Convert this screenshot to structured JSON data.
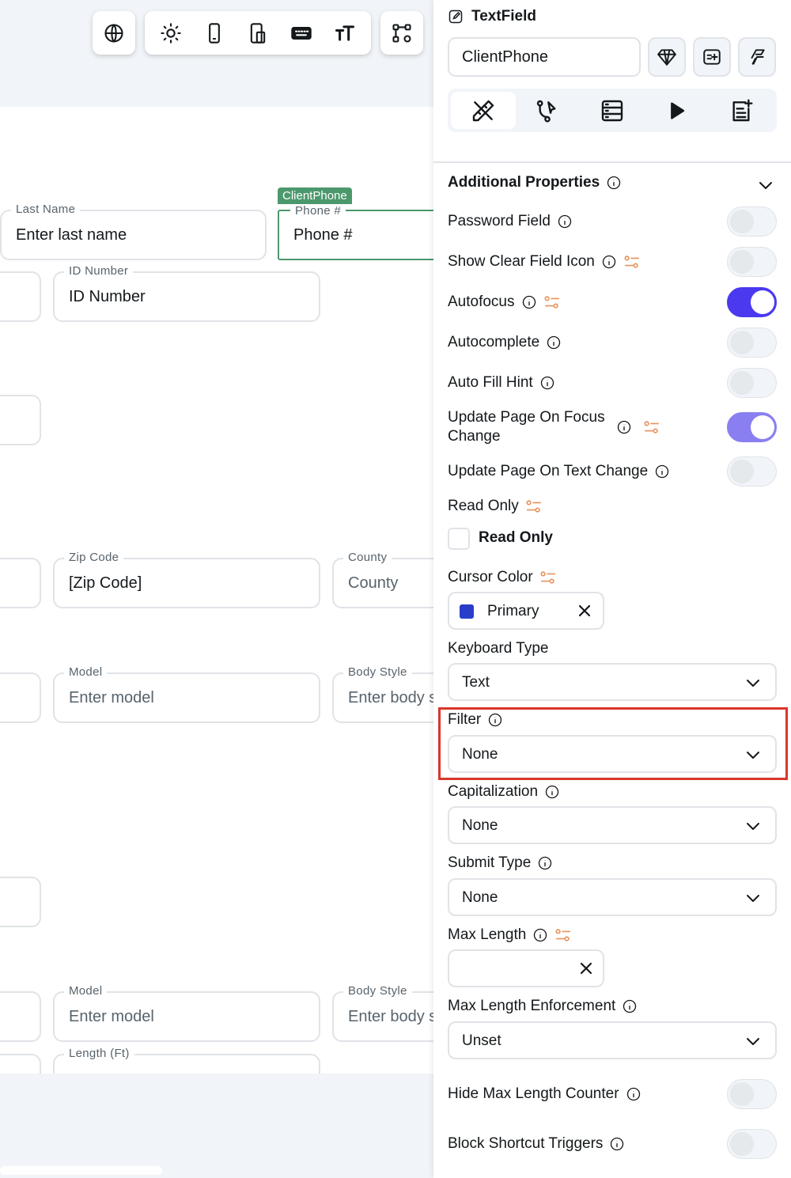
{
  "toolbar": {
    "groups": [
      {
        "icons": [
          "globe-icon"
        ]
      },
      {
        "icons": [
          "sun-icon",
          "phone-icon",
          "tablet-icon",
          "keyboard-icon",
          "text-size-icon"
        ]
      },
      {
        "icons": [
          "component-tree-icon"
        ]
      }
    ]
  },
  "canvas": {
    "fields": {
      "last_name": {
        "label": "Last Name",
        "value": "Enter last name"
      },
      "phone": {
        "label": "Phone #",
        "value": "Phone #",
        "tag": "ClientPhone"
      },
      "id_number": {
        "label": "ID Number",
        "value": "ID Number"
      },
      "zip_code": {
        "label": "Zip Code",
        "value": "[Zip Code]"
      },
      "county": {
        "label": "County",
        "value": "County"
      },
      "model1": {
        "label": "Model",
        "value": "Enter model"
      },
      "body_style1": {
        "label": "Body Style",
        "value": "Enter body s"
      },
      "model2": {
        "label": "Model",
        "value": "Enter model"
      },
      "body_style2": {
        "label": "Body Style",
        "value": "Enter body s"
      },
      "length": {
        "label": "Length (Ft)",
        "value": ""
      }
    }
  },
  "panel": {
    "widget_type": "TextField",
    "widget_name": "ClientPhone",
    "tabs": [
      "properties-tab",
      "actions-tab",
      "backend-query-tab",
      "preview-tab",
      "add-note-tab"
    ],
    "section_title": "Additional Properties",
    "props": {
      "password_field": {
        "label": "Password Field",
        "on": false
      },
      "show_clear": {
        "label": "Show Clear Field Icon",
        "on": false
      },
      "autofocus": {
        "label": "Autofocus",
        "on": true
      },
      "autocomplete": {
        "label": "Autocomplete",
        "on": false
      },
      "auto_fill_hint": {
        "label": "Auto Fill Hint",
        "on": false
      },
      "update_focus": {
        "label_line1": "Update Page On Focus",
        "label_line2": "Change",
        "on": true
      },
      "update_text": {
        "label": "Update Page On Text Change",
        "on": false
      },
      "read_only": {
        "label": "Read Only",
        "checkbox_label": "Read Only",
        "checked": false
      },
      "cursor_color": {
        "label": "Cursor Color",
        "value": "Primary",
        "swatch": "#2a3dc9"
      },
      "keyboard_type": {
        "label": "Keyboard Type",
        "value": "Text"
      },
      "filter": {
        "label": "Filter",
        "value": "None"
      },
      "capitalization": {
        "label": "Capitalization",
        "value": "None"
      },
      "submit_type": {
        "label": "Submit Type",
        "value": "None"
      },
      "max_length": {
        "label": "Max Length",
        "value": ""
      },
      "max_length_enforcement": {
        "label": "Max Length Enforcement",
        "value": "Unset"
      },
      "hide_counter": {
        "label": "Hide Max Length Counter",
        "on": false
      },
      "block_shortcuts": {
        "label": "Block Shortcut Triggers",
        "on": false
      }
    }
  },
  "colors": {
    "accent": "#4b39ef",
    "selection": "#4b986c",
    "highlight": "#d9362b",
    "variable_icon": "#e8925a"
  }
}
